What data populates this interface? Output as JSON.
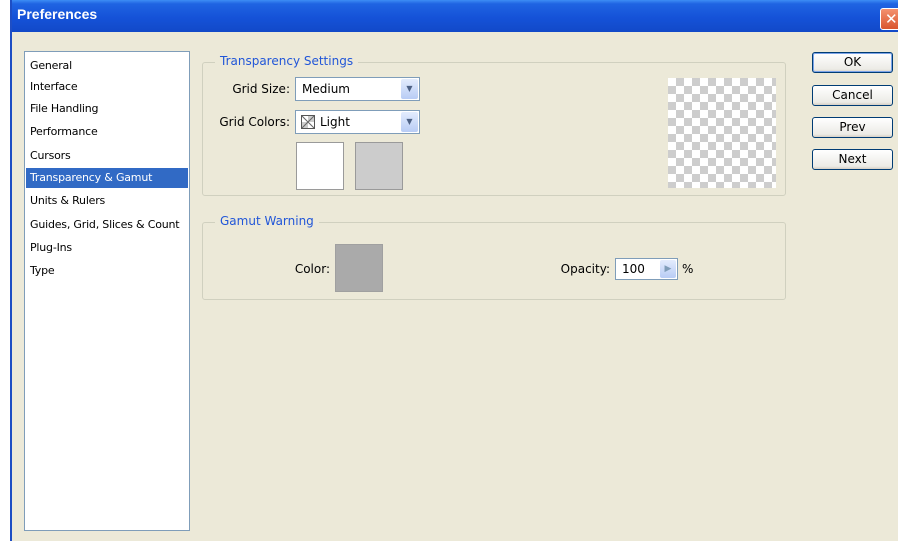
{
  "window": {
    "title": "Preferences",
    "close_glyph": "✕"
  },
  "sidebar": {
    "items": [
      {
        "label": "General"
      },
      {
        "label": "Interface"
      },
      {
        "label": "File Handling"
      },
      {
        "label": "Performance"
      },
      {
        "label": "Cursors"
      },
      {
        "label": "Transparency & Gamut",
        "selected": true
      },
      {
        "label": "Units & Rulers"
      },
      {
        "label": "Guides, Grid, Slices & Count"
      },
      {
        "label": "Plug-Ins"
      },
      {
        "label": "Type"
      }
    ]
  },
  "transparency": {
    "legend": "Transparency Settings",
    "grid_size_label": "Grid Size:",
    "grid_size_value": "Medium",
    "grid_colors_label": "Grid Colors:",
    "grid_colors_value": "Light",
    "swatch_light_color": "#FFFFFF",
    "swatch_dark_color": "#CCCCCC"
  },
  "gamut": {
    "legend": "Gamut Warning",
    "color_label": "Color:",
    "color_value": "#AAAAAA",
    "opacity_label": "Opacity:",
    "opacity_value": "100",
    "opacity_unit": "%"
  },
  "buttons": {
    "ok": "OK",
    "cancel": "Cancel",
    "prev": "Prev",
    "next": "Next"
  },
  "icons": {
    "dropdown": "chevron-down-icon",
    "spinner": "triangle-right-icon",
    "close": "close-icon"
  },
  "colors": {
    "titlebar": "#1552D8",
    "selection": "#316AC5",
    "legend": "#2156D8",
    "dialog_bg": "#ECE9D8"
  }
}
